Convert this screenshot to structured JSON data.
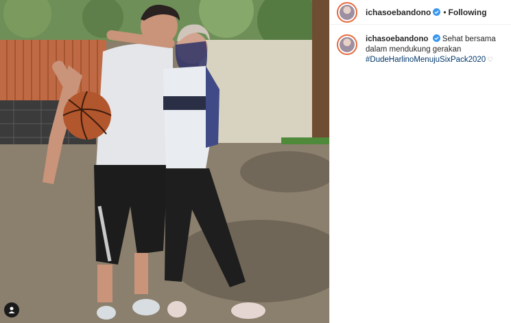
{
  "post": {
    "header": {
      "username": "ichasoebandono",
      "separator": "•",
      "follow_state": "Following"
    },
    "caption": {
      "username": "ichasoebandono",
      "text": "Sehat bersama dalam mendukung gerakan",
      "hashtag": "#DudeHarlinoMenujuSixPack2020",
      "heart": "♡"
    }
  },
  "colors": {
    "verified": "#3897f0",
    "hashtag": "#00376b",
    "avatar_ring": "#e6683c"
  },
  "icons": {
    "verified": "verified-badge-icon",
    "tag": "user-tag-icon",
    "like": "heart-icon"
  }
}
